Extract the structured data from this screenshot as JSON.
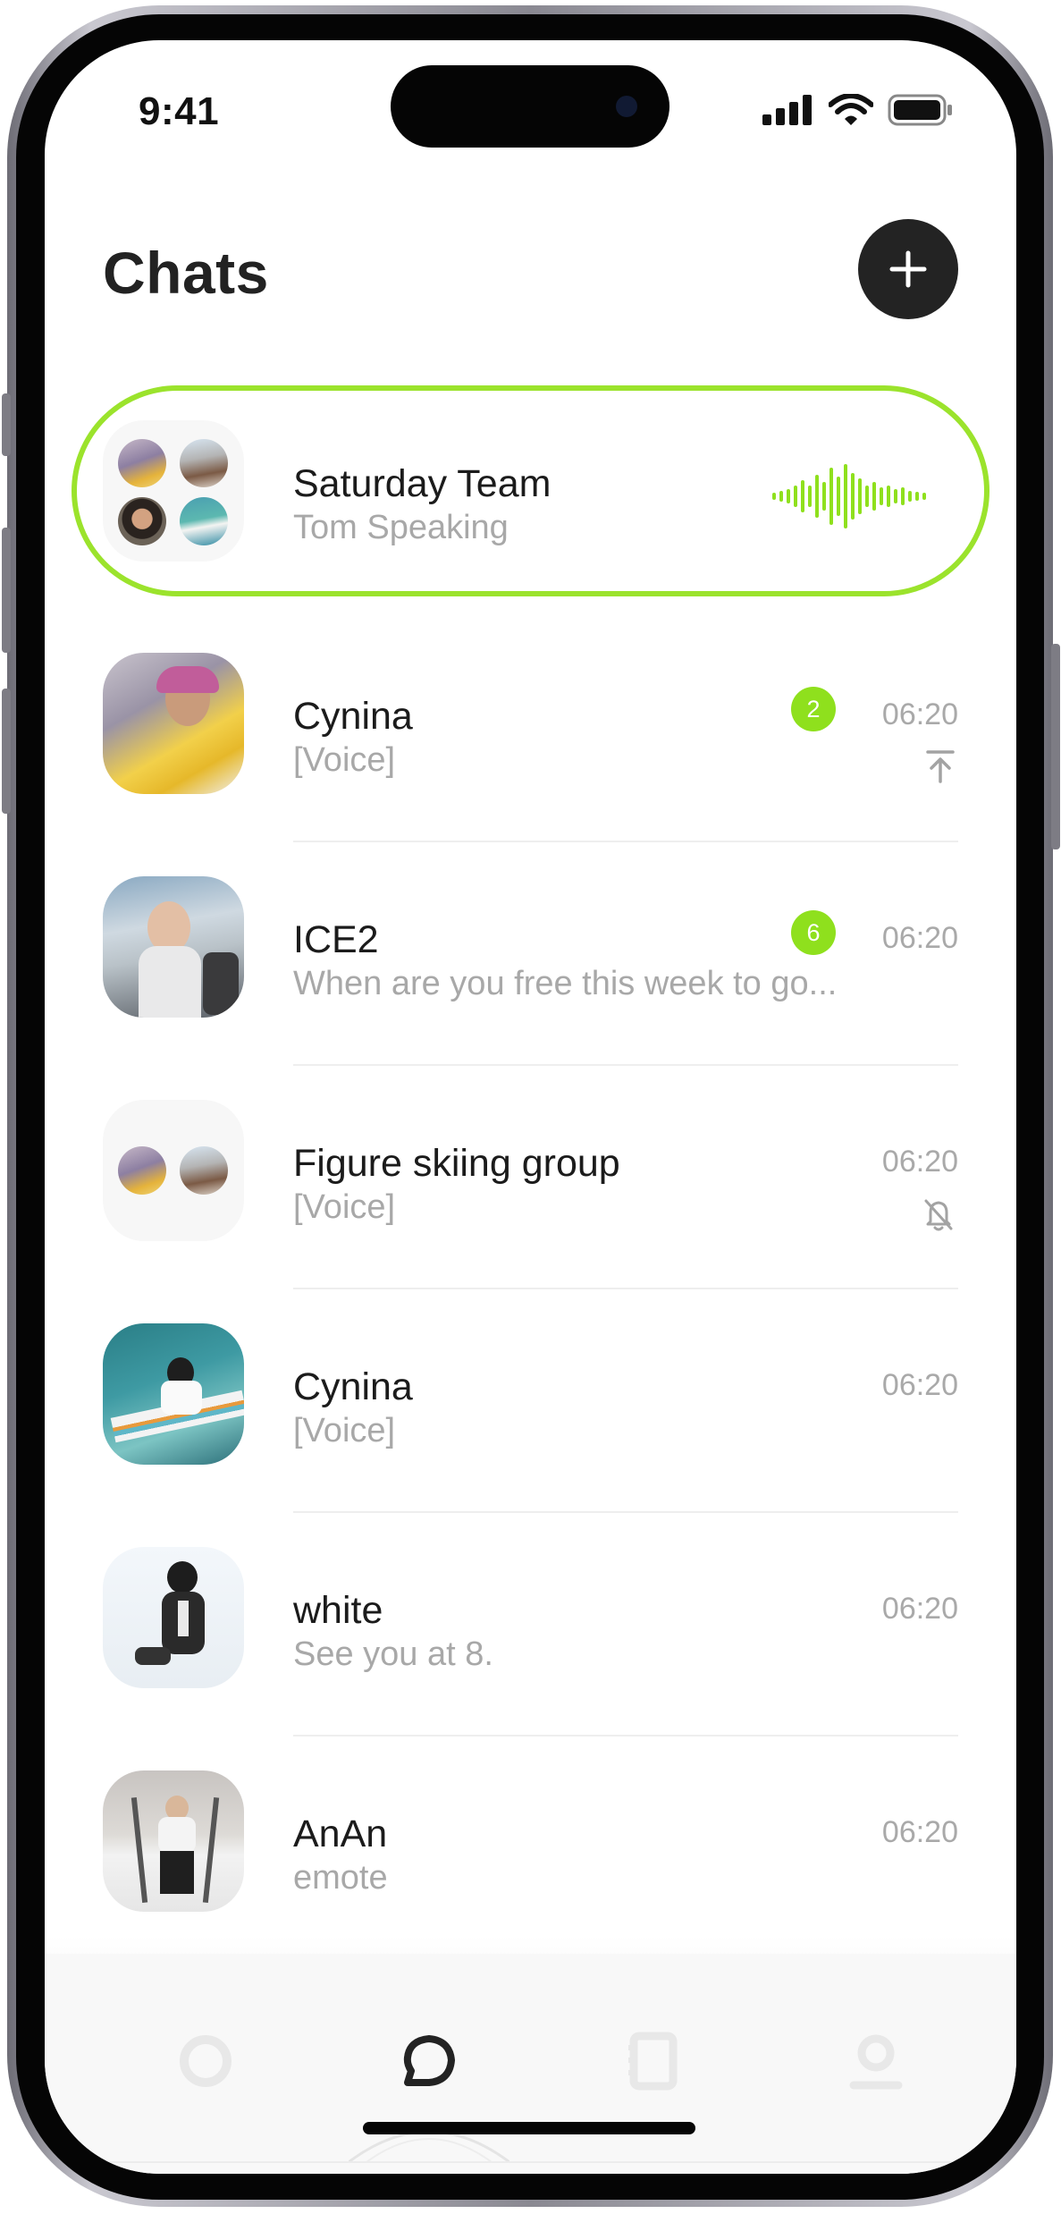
{
  "status_bar": {
    "time": "9:41"
  },
  "header": {
    "title": "Chats",
    "add_icon": "plus-icon"
  },
  "colors": {
    "accent": "#8FE01D",
    "dark": "#232323",
    "muted": "#A8A8A8"
  },
  "active_call": {
    "name": "Saturday Team",
    "status": "Tom Speaking",
    "icon": "voice-waveform-icon"
  },
  "chats": [
    {
      "name": "Cynina",
      "preview": "[Voice]",
      "time": "06:20",
      "unread": "2",
      "icon": "pin-top-icon"
    },
    {
      "name": "ICE2",
      "preview": "When are you free this week to go...",
      "time": "06:20",
      "unread": "6"
    },
    {
      "name": "Figure skiing group",
      "preview": "[Voice]",
      "time": "06:20",
      "icon": "bell-muted-icon"
    },
    {
      "name": "Cynina",
      "preview": "[Voice]",
      "time": "06:20"
    },
    {
      "name": "white",
      "preview": "See you at 8.",
      "time": "06:20"
    },
    {
      "name": "AnAn",
      "preview": "emote",
      "time": "06:20"
    }
  ],
  "nav": [
    {
      "icon": "circle-icon"
    },
    {
      "icon": "chat-bubble-icon",
      "active": true
    },
    {
      "icon": "notebook-icon"
    },
    {
      "icon": "profile-icon"
    }
  ]
}
